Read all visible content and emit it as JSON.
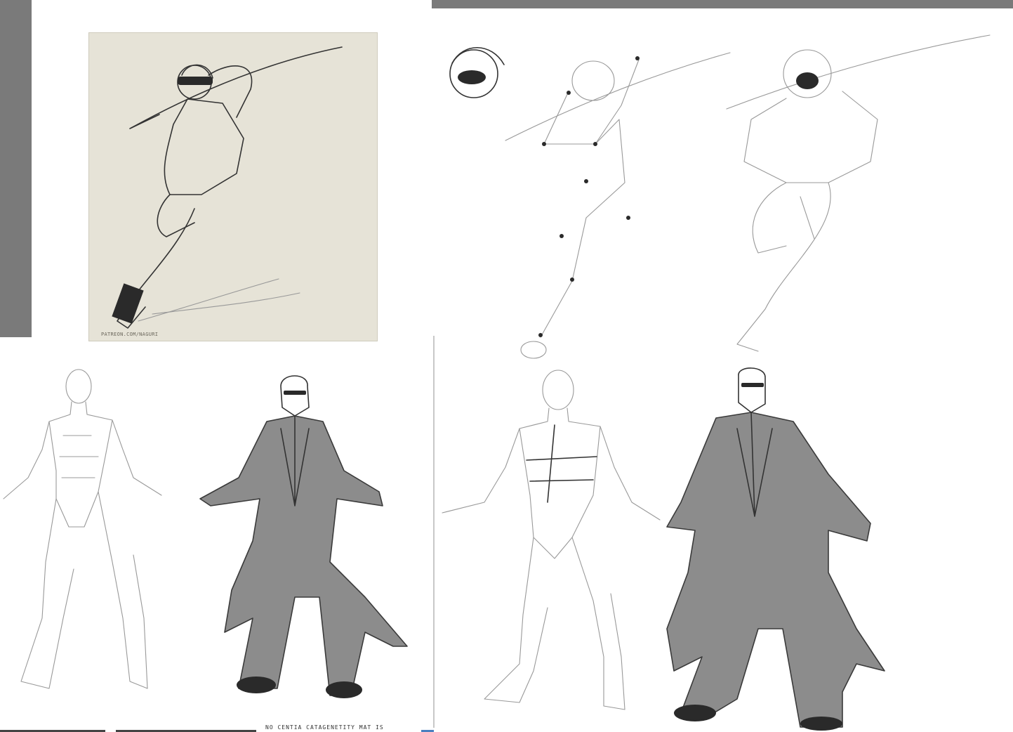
{
  "reference_panel": {
    "watermark": "PATREON.COM/NAGURI",
    "background_color": "#e6e3d7"
  },
  "footer": {
    "partial_text": "NO CENTIA CATAGENETITY MAT IS"
  },
  "colors": {
    "frame_gray": "#7a7a7a",
    "sketch_line": "#333333",
    "tone_gray": "#8c8c8c"
  }
}
